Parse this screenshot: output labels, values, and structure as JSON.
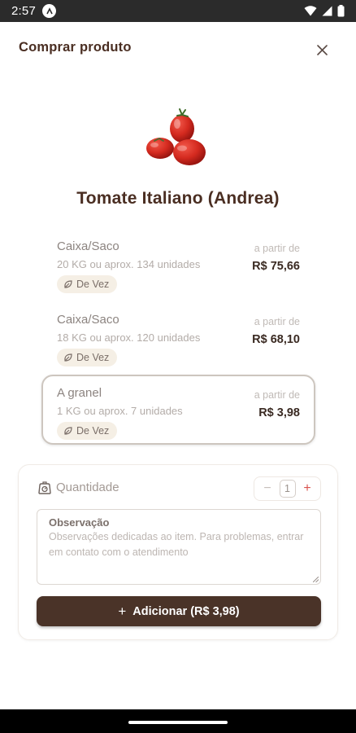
{
  "status_bar": {
    "time": "2:57",
    "app_icon": "notification-app-icon",
    "icons": [
      "wifi-icon",
      "cellular-signal-icon",
      "battery-icon"
    ]
  },
  "header": {
    "title": "Comprar produto",
    "close_icon": "close-icon"
  },
  "product": {
    "image_icon": "tomato-image",
    "name": "Tomate Italiano (Andrea)"
  },
  "options": [
    {
      "name": "Caixa/Saco",
      "description": "20 KG ou aprox. 134 unidades",
      "badge": "De Vez",
      "from_label": "a partir de",
      "price": "R$ 75,66",
      "selected": false
    },
    {
      "name": "Caixa/Saco",
      "description": "18 KG ou aprox. 120 unidades",
      "badge": "De Vez",
      "from_label": "a partir de",
      "price": "R$ 68,10",
      "selected": false
    },
    {
      "name": "A granel",
      "description": "1 KG ou aprox. 7 unidades",
      "badge": "De Vez",
      "from_label": "a partir de",
      "price": "R$ 3,98",
      "selected": true
    }
  ],
  "order": {
    "quantity_label": "Quantidade",
    "quantity_value": "1",
    "minus_label": "−",
    "plus_label": "+",
    "observation_label": "Observação",
    "observation_placeholder": "Observações dedicadas ao item. Para problemas, entrar em contato com o atendimento",
    "add_button_plus": "+",
    "add_button_label": "Adicionar (R$ 3,98)"
  },
  "colors": {
    "brand_dark": "#4a3328",
    "badge_bg": "#f5efe5",
    "plus_accent": "#d9534f"
  }
}
